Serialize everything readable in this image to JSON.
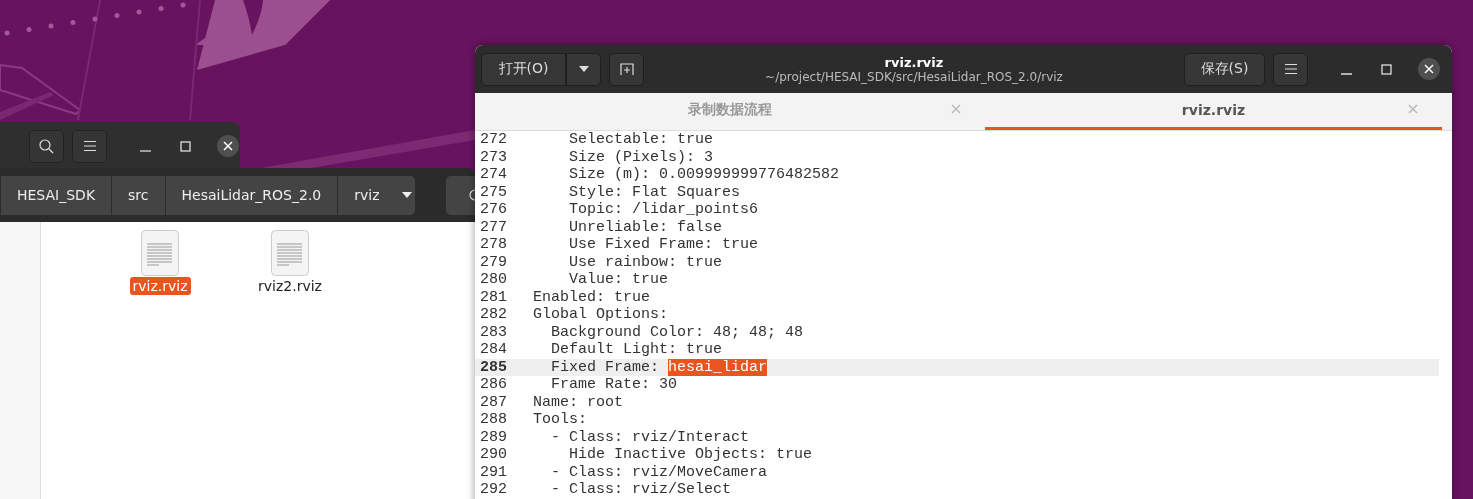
{
  "file_manager": {
    "path_bar": [
      {
        "label": "HESAI_SDK",
        "dropdown": false
      },
      {
        "label": "src",
        "dropdown": false
      },
      {
        "label": "HesaiLidar_ROS_2.0",
        "dropdown": false
      },
      {
        "label": "rviz",
        "dropdown": true
      }
    ],
    "files": [
      {
        "name": "rviz.rviz",
        "selected": true
      },
      {
        "name": "rviz2.rviz",
        "selected": false
      }
    ]
  },
  "editor": {
    "open_button": "打开(O)",
    "save_button": "保存(S)",
    "title": "rviz.rviz",
    "subtitle": "~/project/HESAI_SDK/src/HesaiLidar_ROS_2.0/rviz",
    "tabs": [
      {
        "label": "录制数据流程",
        "selected": false
      },
      {
        "label": "rviz.rviz",
        "selected": true
      }
    ],
    "lines": [
      {
        "number": "272",
        "text": "      Selectable: true",
        "current": false
      },
      {
        "number": "273",
        "text": "      Size (Pixels): 3",
        "current": false
      },
      {
        "number": "274",
        "text": "      Size (m): 0.009999999776482582",
        "current": false
      },
      {
        "number": "275",
        "text": "      Style: Flat Squares",
        "current": false
      },
      {
        "number": "276",
        "text": "      Topic: /lidar_points6",
        "current": false
      },
      {
        "number": "277",
        "text": "      Unreliable: false",
        "current": false
      },
      {
        "number": "278",
        "text": "      Use Fixed Frame: true",
        "current": false
      },
      {
        "number": "279",
        "text": "      Use rainbow: true",
        "current": false
      },
      {
        "number": "280",
        "text": "      Value: true",
        "current": false
      },
      {
        "number": "281",
        "text": "  Enabled: true",
        "current": false
      },
      {
        "number": "282",
        "text": "  Global Options:",
        "current": false
      },
      {
        "number": "283",
        "text": "    Background Color: 48; 48; 48",
        "current": false
      },
      {
        "number": "284",
        "text": "    Default Light: true",
        "current": false
      },
      {
        "number": "285",
        "text": "    Fixed Frame: ",
        "selected_text": "hesai_lidar",
        "current": true
      },
      {
        "number": "286",
        "text": "    Frame Rate: 30",
        "current": false
      },
      {
        "number": "287",
        "text": "  Name: root",
        "current": false
      },
      {
        "number": "288",
        "text": "  Tools:",
        "current": false
      },
      {
        "number": "289",
        "text": "    - Class: rviz/Interact",
        "current": false
      },
      {
        "number": "290",
        "text": "      Hide Inactive Objects: true",
        "current": false
      },
      {
        "number": "291",
        "text": "    - Class: rviz/MoveCamera",
        "current": false
      },
      {
        "number": "292",
        "text": "    - Class: rviz/Select",
        "current": false
      }
    ]
  }
}
